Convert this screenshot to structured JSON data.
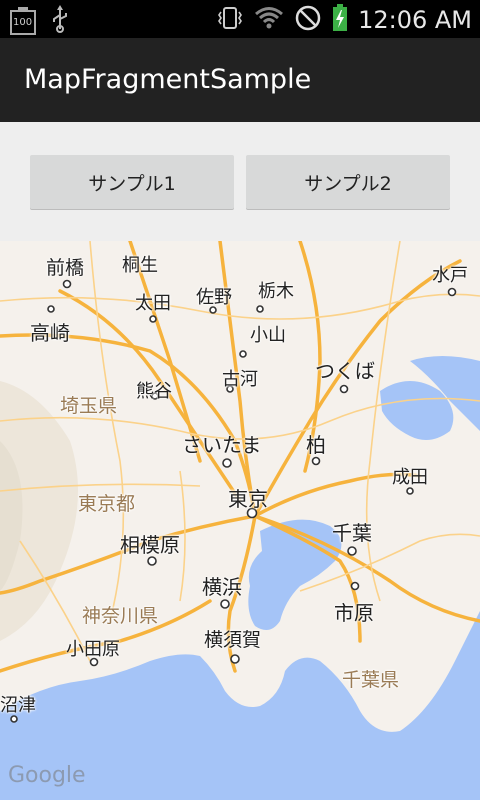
{
  "status_bar": {
    "battery_badge": "100",
    "time": "12:06 AM",
    "icons": [
      "battery-100-icon",
      "usb-icon",
      "vibrate-icon",
      "wifi-icon",
      "do-not-disturb-icon",
      "charging-battery-icon"
    ]
  },
  "app_bar": {
    "title": "MapFragmentSample"
  },
  "buttons": {
    "sample1": "サンプル1",
    "sample2": "サンプル2"
  },
  "map": {
    "attribution": "Google",
    "places": {
      "maebashi": "前橋",
      "kiryu": "桐生",
      "mito": "水戸",
      "ota": "太田",
      "sano": "佐野",
      "tochigi": "栃木",
      "takasaki": "高崎",
      "oyama": "小山",
      "tsukuba": "つくば",
      "kumagaya": "熊谷",
      "koga": "古河",
      "saitama_pref": "埼玉県",
      "saitama": "さいたま",
      "kashiwa": "柏",
      "narita": "成田",
      "tokyo_to": "東京都",
      "tokyo": "東京",
      "sagamihara": "相模原",
      "chiba": "千葉",
      "yokohama": "横浜",
      "kanagawa": "神奈川県",
      "ichihara": "市原",
      "odawara": "小田原",
      "yokosuka": "横須賀",
      "chiba_pref": "千葉県",
      "numazu": "沼津"
    }
  },
  "colors": {
    "action_bar": "#222222",
    "button": "#d8d9d9",
    "sea": "#a5c4f7",
    "land": "#f5f1ec",
    "road": "#f6b33d"
  }
}
